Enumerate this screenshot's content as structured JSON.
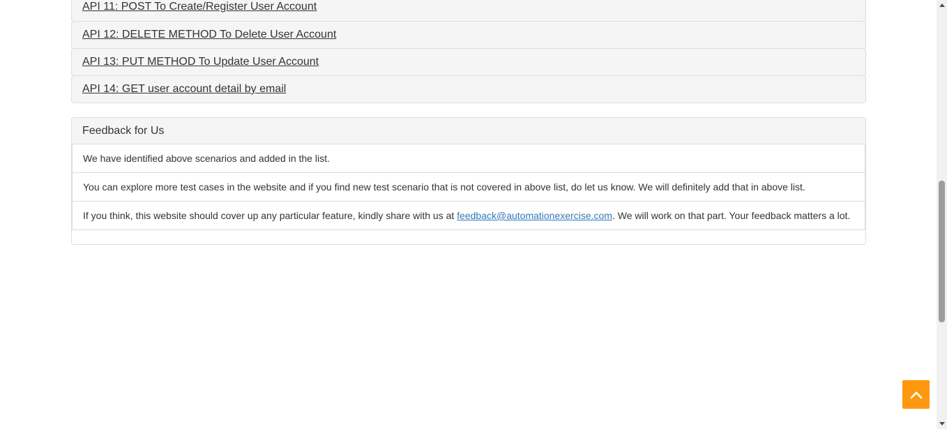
{
  "api_list": {
    "items": [
      {
        "label": "API 11: POST To Create/Register User Account"
      },
      {
        "label": "API 12: DELETE METHOD To Delete User Account"
      },
      {
        "label": "API 13: PUT METHOD To Update User Account"
      },
      {
        "label": "API 14: GET user account detail by email"
      }
    ]
  },
  "feedback": {
    "heading": "Feedback for Us",
    "line1": "We have identified above scenarios and added in the list.",
    "line2": "You can explore more test cases in the website and if you find new test scenario that is not covered in above list, do let us know. We will definitely add that in above list.",
    "line3_prefix": "If you think, this website should cover up any particular feature, kindly share with us at ",
    "email": "feedback@automationexercise.com",
    "line3_suffix": ". We will work on that part. Your feedback matters a lot."
  },
  "icons": {
    "scroll_top": "chevron-up-icon",
    "scrollbar_up": "scrollbar-up-arrow-icon",
    "scrollbar_down": "scrollbar-down-arrow-icon"
  },
  "colors": {
    "accent": "#fe980f",
    "link": "#337ab7",
    "panel_bg": "#f5f5f5",
    "border": "#dddddd"
  }
}
